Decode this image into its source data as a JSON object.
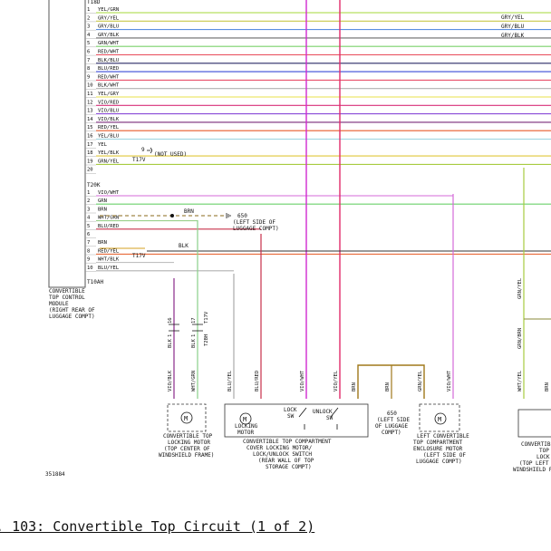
{
  "diagram": {
    "connector_a": {
      "label": "T18D",
      "pins": [
        {
          "n": "1",
          "wire": "YEL/GRN",
          "color": "#a6d83a"
        },
        {
          "n": "2",
          "wire": "GRY/YEL",
          "color": "#c8c84a"
        },
        {
          "n": "3",
          "wire": "GRY/BLU",
          "color": "#5b8fe0"
        },
        {
          "n": "4",
          "wire": "GRY/BLK",
          "color": "#6b6b6b"
        },
        {
          "n": "5",
          "wire": "GRN/WHT",
          "color": "#7ad16a"
        },
        {
          "n": "6",
          "wire": "RED/WHT",
          "color": "#e84b5a"
        },
        {
          "n": "7",
          "wire": "BLK/BLU",
          "color": "#2a2a66"
        },
        {
          "n": "8",
          "wire": "BLU/RED",
          "color": "#3a4ad6"
        },
        {
          "n": "9",
          "wire": "RED/WHT",
          "color": "#e8506a"
        },
        {
          "n": "10",
          "wire": "BLK/WHT",
          "color": "#b0b0b0"
        },
        {
          "n": "11",
          "wire": "YEL/GRY",
          "color": "#e8e04a"
        },
        {
          "n": "12",
          "wire": "VIO/RED",
          "color": "#d8307a"
        },
        {
          "n": "13",
          "wire": "VIO/BLU",
          "color": "#8a4ad8"
        },
        {
          "n": "14",
          "wire": "VIO/BLK",
          "color": "#7a2a7a"
        },
        {
          "n": "15",
          "wire": "RED/YEL",
          "color": "#e85a2a"
        },
        {
          "n": "16",
          "wire": "YEL/BLU",
          "color": "#9ad4e0"
        },
        {
          "n": "17",
          "wire": "YEL",
          "color": ""
        },
        {
          "n": "18",
          "wire": "YEL/BLK",
          "color": "#e0c83a"
        },
        {
          "n": "19",
          "wire": "GRN/YEL",
          "color": "#a8cc40"
        },
        {
          "n": "20",
          "wire": "",
          "color": ""
        }
      ]
    },
    "connector_b": {
      "label": "T20K",
      "pins": [
        {
          "n": "1",
          "wire": "VIO/WHT",
          "color": "#d46ad8"
        },
        {
          "n": "2",
          "wire": "GRN",
          "color": "#6ad06a"
        },
        {
          "n": "3",
          "wire": "BRN",
          "color": ""
        },
        {
          "n": "4",
          "wire": "WHT/GRN",
          "color": "#9ad08a"
        },
        {
          "n": "5",
          "wire": "BLU/RED",
          "color": "#c8304a"
        },
        {
          "n": "6",
          "wire": "",
          "color": ""
        },
        {
          "n": "7",
          "wire": "BRN",
          "color": ""
        },
        {
          "n": "8",
          "wire": "RED/YEL",
          "color": "#e86a3a"
        },
        {
          "n": "9",
          "wire": "WHT/BLK",
          "color": "#c0c0c0"
        },
        {
          "n": "10",
          "wire": "BLU/YEL",
          "color": "#b0b0b0"
        }
      ],
      "footer_label": "T10AH"
    },
    "right_labels": [
      "GRY/YEL",
      "GRY/BLU",
      "GRY/BLK"
    ],
    "pin17_note": "(NOT USED)",
    "pin17_num": "9",
    "t17v_a": "T17V",
    "t17v_b": "T17V",
    "ground_550_a": {
      "label": "650",
      "desc": "(LEFT SIDE OF LUGGAGE COMPT)"
    },
    "ground_550_b": {
      "label": "650",
      "desc": "(LEFT SIDE OF LUGGAGE COMPT)"
    },
    "brn_label": "BRN",
    "blk_label": "BLK",
    "module_label": "CONVERTIBLE TOP CONTROL MODULE (RIGHT REAR OF LUGGAGE COMPT)",
    "vertical_wires": {
      "a": "VIO/BLK",
      "b": "WHT/GRN",
      "c": "BLU/YEL",
      "d": "BLU/RED",
      "e": "VIO/WHT",
      "f": "VIO/YEL",
      "g": "BRN",
      "h": "BRN",
      "i": "GRN/YEL",
      "j": "VIO/WHT",
      "k": "GRN/YEL",
      "l": "GRN/BRN",
      "m": "WHT/YEL",
      "n": "BRN"
    },
    "mid_conn_labels": [
      "16",
      "17",
      "T17V",
      "1",
      "1",
      "T2BH",
      "BLK",
      "BLK"
    ],
    "components": {
      "motor1": "CONVERTIBLE TOP LOCKING MOTOR (TOP CENTER OF WINDSHIELD FRAME)",
      "locking_motor": "LOCKING MOTOR",
      "lock_sw": "LOCK SW",
      "unlock_sw": "UNLOCK SW",
      "switch_box": "CONVERTIBLE TOP COMPARTMENT COVER LOCKING MOTOR/ LOCK/UNLOCK SWITCH (REAR WALL OF TOP STORAGE COMPT)",
      "motor2": "LEFT CONVERTIBLE TOP COMPARTMENT ENCLOSURE MOTOR (LEFT SIDE OF LUGGAGE COMPT)",
      "right_partial": "CONVERTIBLE TOP LEFT LOCK SWITCH (TOP LEFT SIDE OF WINDSHIELD FRAME)"
    },
    "ref_number": "351884"
  },
  "caption": "g. 103: Convertible Top Circuit (1 of 2)"
}
